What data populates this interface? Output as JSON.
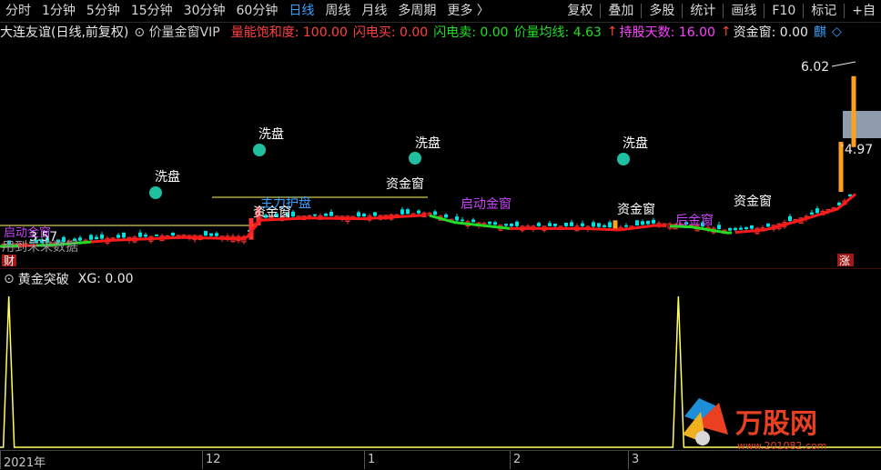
{
  "toolbar": {
    "periods": [
      "分时",
      "1分钟",
      "5分钟",
      "15分钟",
      "30分钟",
      "60分钟",
      "日线",
      "周线",
      "月线",
      "多周期",
      "更多 〉"
    ],
    "active_period": "日线",
    "right_items": [
      "复权",
      "叠加",
      "多股",
      "统计",
      "画线",
      "F10",
      "标记",
      "+自"
    ]
  },
  "infobar": {
    "stock_title": "大连友谊(日线,前复权)",
    "indicator_name": "价量金窗VIP",
    "volume_saturation": "量能饱和度: 100.00",
    "flash_buy": "闪电买: 0.00",
    "flash_sell": "闪电卖: 0.00",
    "price_volume_avg": "价量均线: 4.63",
    "holding_days": "持股天数: 16.00",
    "capital_window": "资金窗: 0.00",
    "extra_tag": "麒"
  },
  "main_chart": {
    "high_label": "6.02",
    "current_label": "4.97",
    "low_label": "3.57",
    "labels": {
      "xipan": "洗盘",
      "zijinchuang": "资金窗",
      "houjinchuang": "后金窗",
      "qidongzhijin": "启动金窗",
      "zhuli_hupan": "主力护盘",
      "future_data": "用到未来数据",
      "cai": "财",
      "zhang": "涨"
    },
    "colors": {
      "up": "#ff3030",
      "down": "#00e0e0",
      "ma_red": "#ff1a1a",
      "ma_green": "#22dd22",
      "yellow": "#ffff60",
      "highlight": "#9aa7b8"
    }
  },
  "sub_chart": {
    "title": "黄金突破",
    "value": "XG: 0.00",
    "color": "#ffff60"
  },
  "xaxis": {
    "labels": [
      "2021年",
      "12",
      "1",
      "2",
      "3"
    ]
  },
  "watermark": {
    "brand": "万股网",
    "url": "www.201082.com"
  },
  "chart_data": {
    "type": "candlestick",
    "title": "大连友谊(日线,前复权)",
    "ylim": [
      3.4,
      6.2
    ],
    "annotated_prices": {
      "high": 6.02,
      "current": 4.97,
      "low": 3.57
    },
    "sub_indicator": {
      "name": "XG",
      "spikes_at_bar_fraction": [
        0.01,
        0.77
      ]
    }
  }
}
